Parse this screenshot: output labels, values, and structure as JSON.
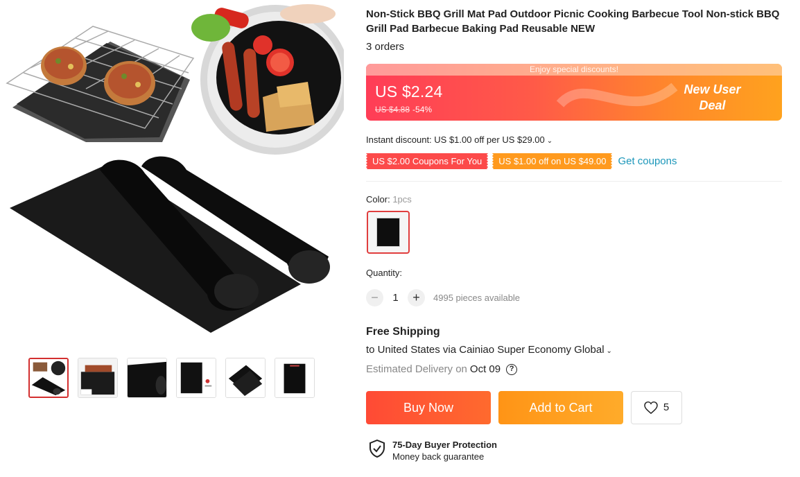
{
  "product": {
    "title": "Non-Stick BBQ Grill Mat Pad Outdoor Picnic Cooking Barbecue Tool Non-stick BBQ Grill Pad Barbecue Baking Pad Reusable NEW",
    "orders": "3 orders"
  },
  "price": {
    "banner_text": "Enjoy special discounts!",
    "current": "US $2.24",
    "original": "US $4.88",
    "discount": "-54%",
    "deal_line1": "New User",
    "deal_line2": "Deal"
  },
  "discounts": {
    "instant": "Instant discount: US $1.00 off per US $29.00",
    "coupon1": "US $2.00 Coupons For You",
    "coupon2": "US $1.00 off on US $49.00",
    "get_coupons": "Get coupons"
  },
  "color": {
    "label": "Color:",
    "value": "1pcs"
  },
  "quantity": {
    "label": "Quantity:",
    "minus": "−",
    "value": "1",
    "plus": "+",
    "available": "4995 pieces available"
  },
  "shipping": {
    "title": "Free Shipping",
    "line": "to United States via Cainiao Super Economy Global",
    "estimated_label": "Estimated Delivery on",
    "date": "Oct 09",
    "help": "?"
  },
  "actions": {
    "buy_now": "Buy Now",
    "add_to_cart": "Add to Cart",
    "wishlist_count": "5"
  },
  "protection": {
    "title": "75-Day Buyer Protection",
    "subtitle": "Money back guarantee"
  },
  "colors": {
    "accent_red": "#fc4a4a",
    "accent_orange": "#ff9a1e",
    "link_blue": "#1c97ba"
  }
}
